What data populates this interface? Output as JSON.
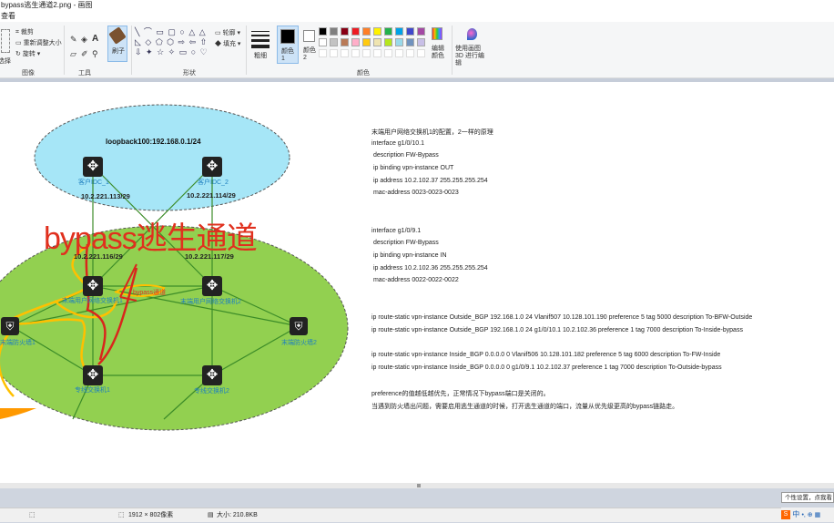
{
  "window": {
    "title": "bypass逃生通道2.png - 画图"
  },
  "menu": {
    "label": "查看"
  },
  "ribbon": {
    "image_group": {
      "crop": "裁剪",
      "resize": "重新调整大小",
      "rotate": "旋转",
      "select_label": "选择",
      "label": "图像"
    },
    "tools_label": "工具",
    "brush_label": "刷子",
    "shapes": {
      "outline": "轮廓",
      "fill": "填充",
      "label": "形状"
    },
    "size_label": "粗细",
    "color1_label": "颜色 1",
    "color2_label": "颜色 2",
    "colors_label": "颜色",
    "edit_colors_label": "编辑颜色",
    "paint3d_label": "使用画图 3D 进行编辑",
    "palette_row1": [
      "#000000",
      "#7f7f7f",
      "#880015",
      "#ed1c24",
      "#ff7f27",
      "#fff200",
      "#22b14c",
      "#00a2e8",
      "#3f48cc",
      "#a349a4"
    ],
    "palette_row2": [
      "#ffffff",
      "#c3c3c3",
      "#b97a57",
      "#ffaec9",
      "#ffc90e",
      "#efe4b0",
      "#b5e61d",
      "#99d9ea",
      "#7092be",
      "#c8bfe7"
    ],
    "color1": "#000000",
    "color2": "#ffffff"
  },
  "diagram": {
    "title": "bypass逃生通道",
    "loopback_label": "loopback100:192.168.0.1/24",
    "nodes": {
      "dc1": "客户IDC_1",
      "dc2": "客户IDC_2",
      "sw1": "末端用户网络交换机1",
      "sw2": "末端用户网络交换机2",
      "fw1": "末端防火墙1",
      "fw2": "末端防火墙2",
      "core1": "专线交换机1",
      "core2": "专线交换机2",
      "bypass_link": "bypass通道"
    },
    "ips": {
      "dc1": "10.2.221.113/29",
      "dc2": "10.2.221.114/29",
      "sw1": "10.2.221.116/29",
      "sw2": "10.2.221.117/29"
    },
    "colors": {
      "top_ellipse": "#a6e6f7",
      "bottom_ellipse": "#92d050",
      "bypass_text": "#e0301e",
      "path_yellow": "#ffc000",
      "path_red": "#d9261c"
    }
  },
  "config_lines": [
    "末端用户网络交换机1的配置，2一样的原理",
    "interface g1/0/10.1",
    " description FW-Bypass",
    " ip binding vpn-instance OUT",
    " ip address 10.2.102.37 255.255.255.254",
    " mac-address 0023-0023-0023",
    "",
    "",
    "interface g1/0/9.1",
    " description FW-Bypass",
    " ip binding vpn-instance IN",
    " ip address 10.2.102.36 255.255.255.254",
    " mac-address 0022-0022-0022",
    "",
    "",
    "ip route-static vpn-instance Outside_BGP 192.168.1.0 24 Vlanif507 10.128.101.190 preference 5 tag 5000 description To-BFW-Outside",
    "ip route-static vpn-instance Outside_BGP 192.168.1.0 24 g1/0/10.1 10.2.102.36 preference 1 tag 7000 description To-Inside-bypass",
    "",
    "ip route-static vpn-instance Inside_BGP 0.0.0.0 0 Vlanif506 10.128.101.182 preference 5 tag 6000 description To-FW-Inside",
    "ip route-static vpn-instance Inside_BGP 0.0.0.0 0 g1/0/9.1 10.2.102.37 preference 1 tag 7000 description To-Outside-bypass",
    "",
    "preference的值越低越优先，正常情况下bypass端口是关闭的。",
    "当遇到防火墙出问题，需要启用逃生通道的时候，打开逃生通道的端口，流量从优先级更高的bypass链路走。"
  ],
  "status": {
    "dimensions": "1912 × 802像素",
    "size": "大小: 210.8KB"
  },
  "tray": {
    "ime": "中",
    "tooltip": "个性设置，点我看"
  }
}
